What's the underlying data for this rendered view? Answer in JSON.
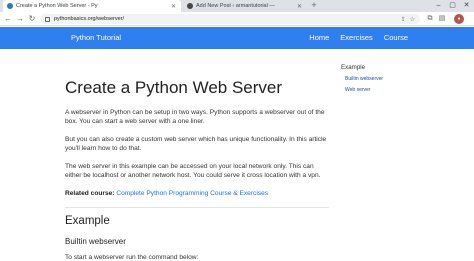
{
  "browser": {
    "tabs": [
      {
        "title": "Create a Python Web Server - Py",
        "active": true
      },
      {
        "title": "Add New Post ‹ armantutorial —",
        "active": false
      }
    ],
    "url": "pythonbasics.org/webserver/"
  },
  "navbar": {
    "brand": "Python Tutorial",
    "links": [
      "Home",
      "Exercises",
      "Course"
    ],
    "color": "#2f7ff0"
  },
  "article": {
    "title": "Create a Python Web Server",
    "paragraphs": [
      "A webserver in Python can be setup in two ways. Python supports a webserver out of the box. You can start a web server with a one liner.",
      "But you can also create a custom web server which has unique functionality. In this article you'll learn how to do that.",
      "The web server in this example can be accessed on your local network only. This can either be localhost or another network host. You could serve it cross location with a vpn."
    ],
    "related_label": "Related course:",
    "related_link": "Complete Python Programming Course & Exercises",
    "section_heading": "Example",
    "subheading": "Builtin webserver",
    "cut_line": "To start a webserver run the command below:"
  },
  "sidebar": {
    "title": "Example",
    "links": [
      "Builtin webserver",
      "Web server"
    ]
  }
}
